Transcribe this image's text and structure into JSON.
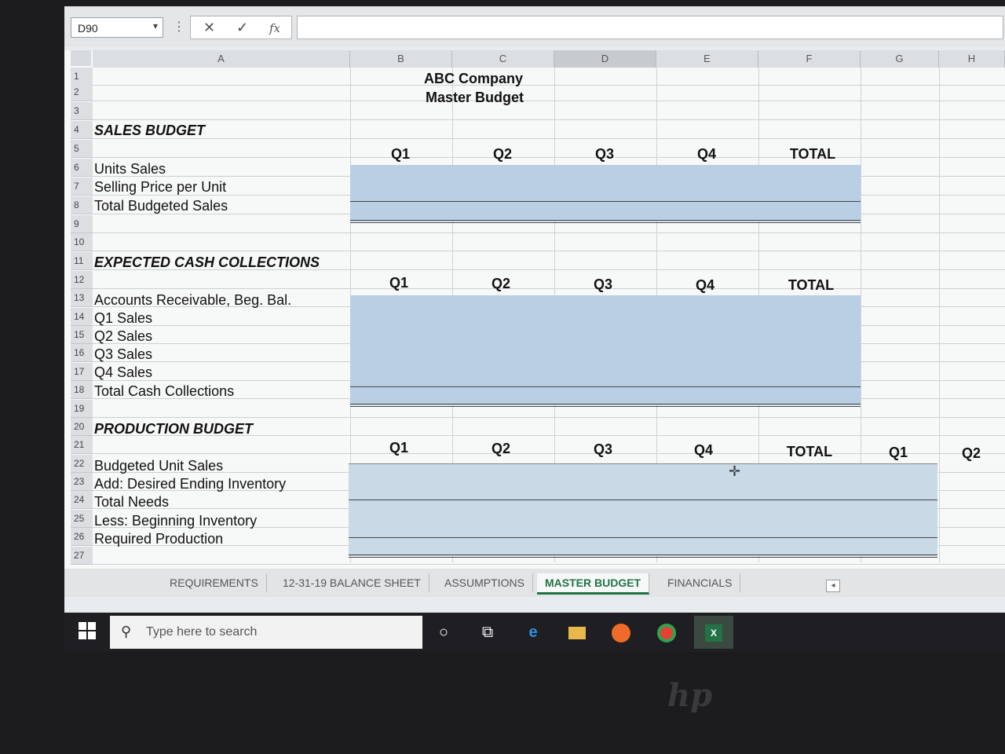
{
  "formula_bar": {
    "name_box": "D90",
    "cancel_icon": "✕",
    "enter_icon": "✓",
    "fx_icon": "fx",
    "formula": ""
  },
  "columns": [
    "A",
    "B",
    "C",
    "D",
    "E",
    "F",
    "G",
    "H"
  ],
  "rows": [
    "1",
    "2",
    "3",
    "4",
    "5",
    "6",
    "7",
    "8",
    "9",
    "10",
    "11",
    "12",
    "13",
    "14",
    "15",
    "16",
    "17",
    "18",
    "19",
    "20",
    "21",
    "22",
    "23",
    "24",
    "25",
    "26",
    "27"
  ],
  "title": {
    "company": "ABC Company",
    "subtitle": "Master Budget"
  },
  "sales_budget": {
    "heading": "SALES BUDGET",
    "quarters": [
      "Q1",
      "Q2",
      "Q3",
      "Q4",
      "TOTAL"
    ],
    "lines": [
      "Units Sales",
      "Selling Price per Unit",
      "Total Budgeted Sales"
    ]
  },
  "cash_collections": {
    "heading": "EXPECTED CASH COLLECTIONS",
    "quarters": [
      "Q1",
      "Q2",
      "Q3",
      "Q4",
      "TOTAL"
    ],
    "lines": [
      "Accounts Receivable, Beg. Bal.",
      "Q1 Sales",
      "Q2 Sales",
      "Q3 Sales",
      "Q4 Sales",
      "Total Cash Collections"
    ]
  },
  "production_budget": {
    "heading": "PRODUCTION BUDGET",
    "quarters": [
      "Q1",
      "Q2",
      "Q3",
      "Q4",
      "TOTAL",
      "Q1",
      "Q2"
    ],
    "lines": [
      "Budgeted Unit Sales",
      "Add: Desired Ending Inventory",
      "Total Needs",
      "Less: Beginning Inventory",
      "Required Production"
    ]
  },
  "sheet_tabs": [
    {
      "label": "REQUIREMENTS",
      "active": false
    },
    {
      "label": "12-31-19 BALANCE SHEET",
      "active": false
    },
    {
      "label": "ASSUMPTIONS",
      "active": false
    },
    {
      "label": "MASTER BUDGET",
      "active": true
    },
    {
      "label": "FINANCIALS",
      "active": false
    }
  ],
  "taskbar": {
    "search_placeholder": "Type here to search",
    "icons": [
      "cortana-icon",
      "task-view-icon",
      "edge-icon",
      "file-explorer-icon",
      "firefox-icon",
      "chrome-icon",
      "excel-icon"
    ]
  },
  "bezel_logo": "hp",
  "colors": {
    "accent": "#217346",
    "input_shade": "#b9cfe3"
  }
}
